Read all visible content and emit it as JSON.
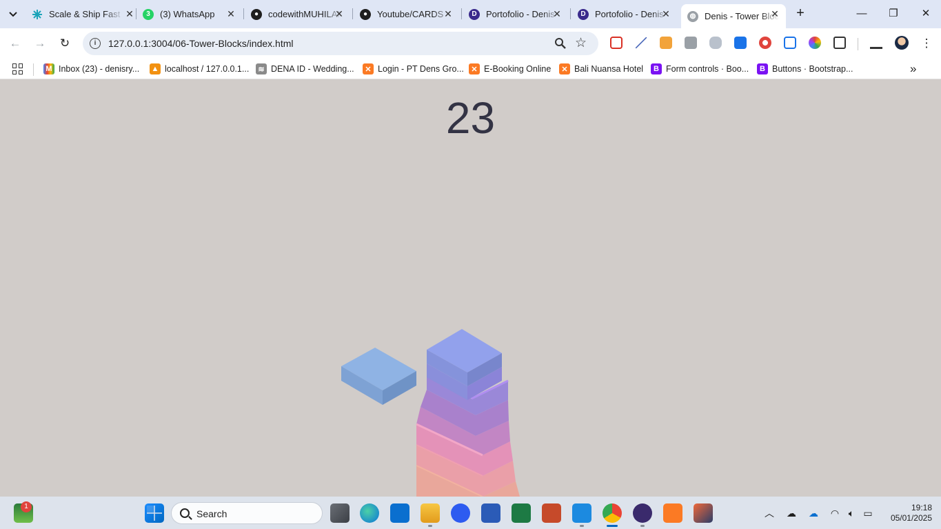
{
  "browser": {
    "tabs": [
      {
        "title": "Scale & Ship Fast",
        "active": false
      },
      {
        "title": "(3) WhatsApp",
        "active": false
      },
      {
        "title": "codewithMUHILAN",
        "active": false
      },
      {
        "title": "Youtube/CARDS",
        "active": false
      },
      {
        "title": "Portofolio - Denis",
        "active": false
      },
      {
        "title": "Portofolio - Denis",
        "active": false
      },
      {
        "title": "Denis - Tower Blocks",
        "active": true
      }
    ],
    "url": "127.0.0.1:3004/06-Tower-Blocks/index.html",
    "bookmarks": [
      {
        "label": "Inbox (23) - denisry..."
      },
      {
        "label": "localhost / 127.0.0.1..."
      },
      {
        "label": "DENA ID - Wedding..."
      },
      {
        "label": "Login - PT Dens Gro..."
      },
      {
        "label": "E-Booking Online"
      },
      {
        "label": "Bali Nuansa Hotel"
      },
      {
        "label": "Form controls · Boo..."
      },
      {
        "label": "Buttons · Bootstrap..."
      }
    ]
  },
  "game": {
    "score": "23",
    "colors": {
      "background": "#d1ccc9",
      "score_text": "#333344",
      "moving_block": "#87acde",
      "top_block": "#8c9de8"
    }
  },
  "taskbar": {
    "search_label": "Search",
    "notification_count": "1",
    "time": "19:18",
    "date": "05/01/2025"
  }
}
